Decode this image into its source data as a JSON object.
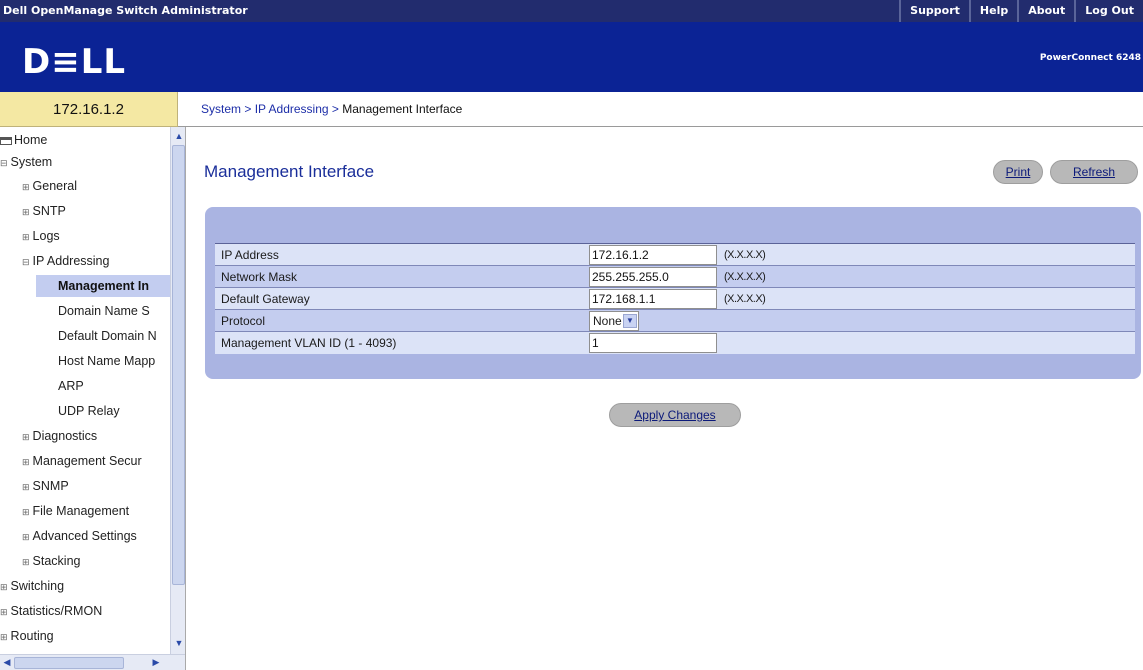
{
  "header": {
    "app_title": "Dell OpenManage Switch Administrator",
    "links": [
      "Support",
      "Help",
      "About",
      "Log Out"
    ]
  },
  "banner": {
    "logo": "D≡LL",
    "product": "PowerConnect 6248"
  },
  "device_ip": "172.16.1.2",
  "breadcrumb": {
    "items": [
      "System",
      "IP Addressing",
      "Management Interface"
    ],
    "separator": ">"
  },
  "sidebar": {
    "items": [
      {
        "label": "Home",
        "expander": ""
      },
      {
        "label": "System",
        "expander": "⊟"
      },
      {
        "label": "General",
        "expander": "⊞"
      },
      {
        "label": "SNTP",
        "expander": "⊞"
      },
      {
        "label": "Logs",
        "expander": "⊞"
      },
      {
        "label": "IP Addressing",
        "expander": "⊟"
      },
      {
        "label": "Management In",
        "expander": ""
      },
      {
        "label": "Domain Name S",
        "expander": ""
      },
      {
        "label": "Default Domain N",
        "expander": ""
      },
      {
        "label": "Host Name Mapp",
        "expander": ""
      },
      {
        "label": "ARP",
        "expander": ""
      },
      {
        "label": "UDP Relay",
        "expander": ""
      },
      {
        "label": "Diagnostics",
        "expander": "⊞"
      },
      {
        "label": "Management Secur",
        "expander": "⊞"
      },
      {
        "label": "SNMP",
        "expander": "⊞"
      },
      {
        "label": "File Management",
        "expander": "⊞"
      },
      {
        "label": "Advanced Settings",
        "expander": "⊞"
      },
      {
        "label": "Stacking",
        "expander": "⊞"
      },
      {
        "label": "Switching",
        "expander": "⊞"
      },
      {
        "label": "Statistics/RMON",
        "expander": "⊞"
      },
      {
        "label": "Routing",
        "expander": "⊞"
      }
    ]
  },
  "main": {
    "title": "Management Interface",
    "print_label": "Print",
    "refresh_label": "Refresh",
    "apply_label": "Apply Changes",
    "form": {
      "ip_address": {
        "label": "IP Address",
        "value": "172.16.1.2",
        "hint": "(X.X.X.X)"
      },
      "network_mask": {
        "label": "Network Mask",
        "value": "255.255.255.0",
        "hint": "(X.X.X.X)"
      },
      "default_gateway": {
        "label": "Default Gateway",
        "value": "172.168.1.1",
        "hint": "(X.X.X.X)"
      },
      "protocol": {
        "label": "Protocol",
        "value": "None"
      },
      "vlan": {
        "label": "Management VLAN ID (1 - 4093)",
        "value": "1"
      }
    }
  },
  "colors": {
    "topbar": "#222c6e",
    "banner": "#0b2395",
    "ip_box": "#f4e8a3",
    "panel": "#aab4e2",
    "title_text": "#1a2e9a"
  }
}
